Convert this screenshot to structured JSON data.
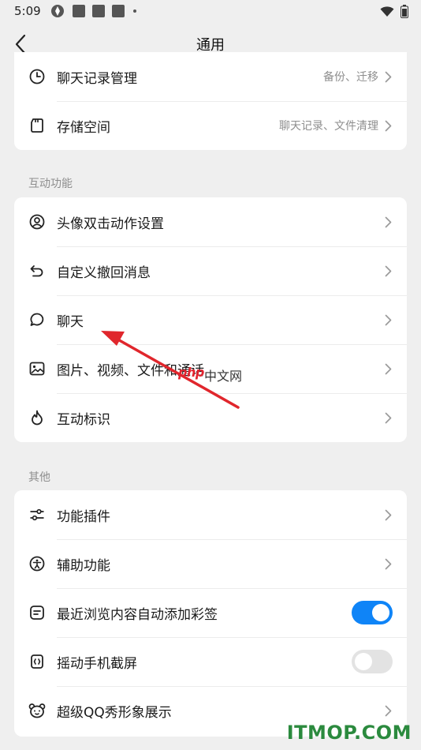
{
  "status_bar": {
    "time": "5:09"
  },
  "nav": {
    "title": "通用"
  },
  "card1": {
    "items": [
      {
        "label": "聊天记录管理",
        "value": "备份、迁移"
      },
      {
        "label": "存储空间",
        "value": "聊天记录、文件清理"
      }
    ]
  },
  "section_interactive": {
    "title": "互动功能",
    "items": [
      {
        "label": "头像双击动作设置"
      },
      {
        "label": "自定义撤回消息"
      },
      {
        "label": "聊天"
      },
      {
        "label": "图片、视频、文件和通话"
      },
      {
        "label": "互动标识"
      }
    ]
  },
  "section_other": {
    "title": "其他",
    "items": [
      {
        "label": "功能插件"
      },
      {
        "label": "辅助功能"
      },
      {
        "label": "最近浏览内容自动添加彩签",
        "toggle": "on"
      },
      {
        "label": "摇动手机截屏",
        "toggle": "off"
      },
      {
        "label": "超级QQ秀形象展示"
      }
    ]
  },
  "watermarks": {
    "php": "php",
    "cn": "中文网",
    "brand": "ITMOP.COM"
  },
  "colors": {
    "accent": "#0f84f7",
    "arrow": "#e0262c",
    "brand": "#2b8a3e"
  }
}
